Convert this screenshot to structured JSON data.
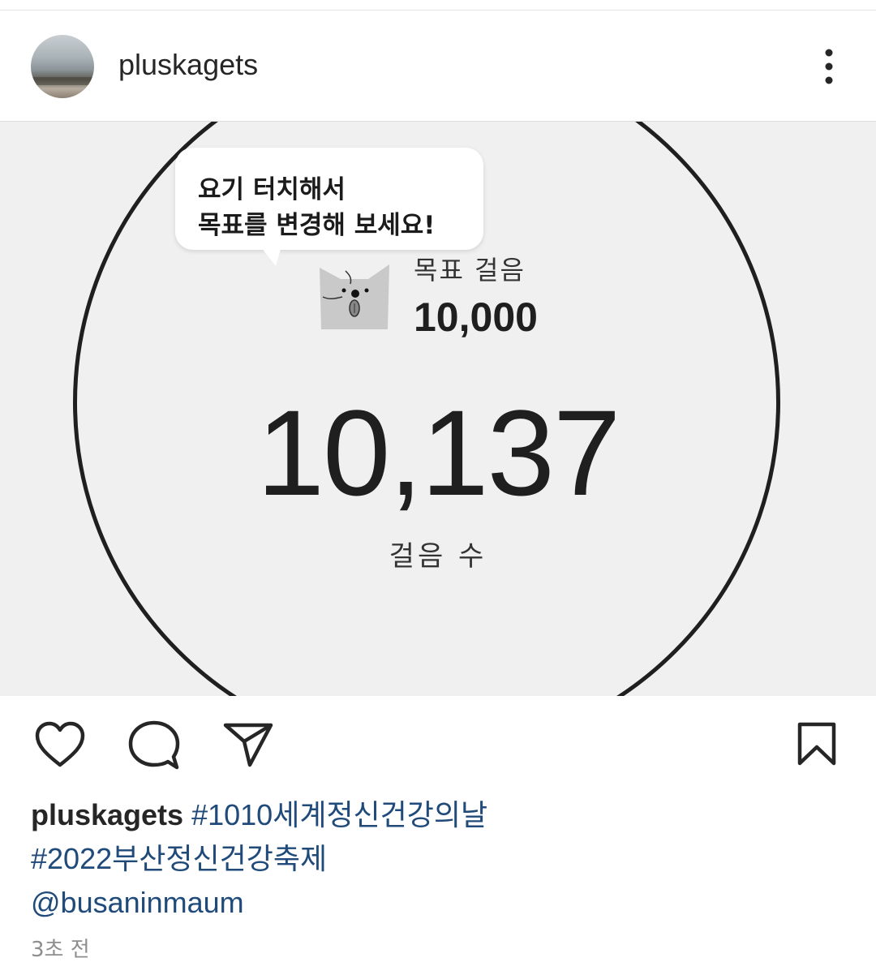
{
  "post": {
    "username": "pluskagets",
    "more_icon": "more-vertical-icon"
  },
  "media": {
    "bubble": {
      "line1": "요기 터치해서",
      "line2": "목표를 변경해 보세요!"
    },
    "goal_label": "목표 걸음",
    "goal_value": "10,000",
    "step_count": "10,137",
    "step_label": "걸음 수"
  },
  "actions": {
    "like_icon": "heart-icon",
    "comment_icon": "comment-icon",
    "share_icon": "send-icon",
    "save_icon": "bookmark-icon"
  },
  "caption": {
    "username": "pluskagets",
    "hashtag1": "#1010세계정신건강의날",
    "hashtag2": "#2022부산정신건강축제",
    "mention": "@busaninmaum"
  },
  "timestamp": "3초 전"
}
